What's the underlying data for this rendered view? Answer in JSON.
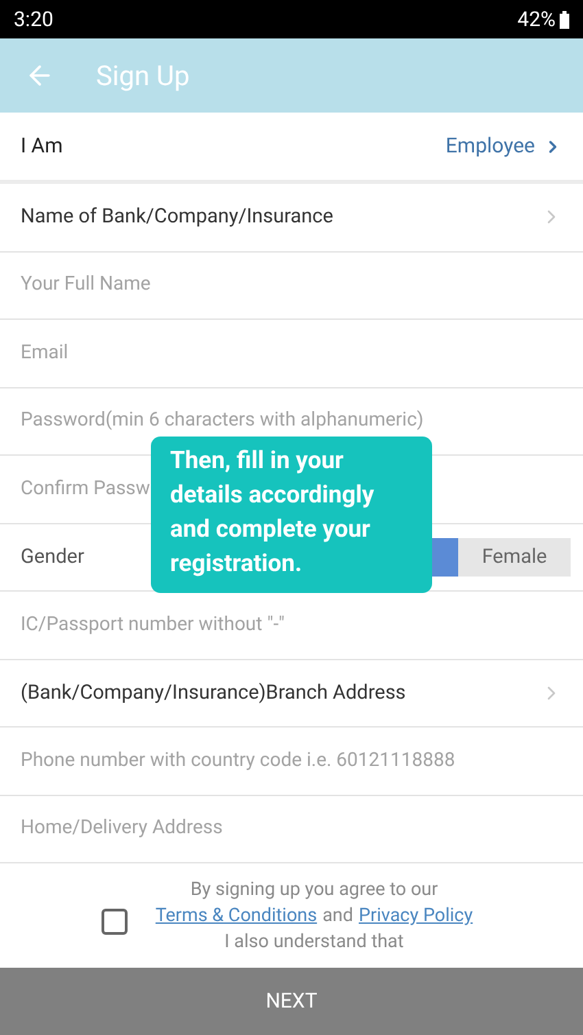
{
  "status_bar": {
    "time": "3:20",
    "battery": "42%"
  },
  "header": {
    "title": "Sign Up"
  },
  "role_row": {
    "label": "I Am",
    "value": "Employee"
  },
  "fields": [
    {
      "kind": "select",
      "label": "Name of Bank/Company/Insurance"
    },
    {
      "kind": "input",
      "placeholder": "Your Full Name"
    },
    {
      "kind": "input",
      "placeholder": "Email"
    },
    {
      "kind": "input",
      "placeholder": "Password(min 6 characters with alphanumeric)"
    },
    {
      "kind": "input",
      "placeholder": "Confirm Passw"
    },
    {
      "kind": "gender",
      "label": "Gender",
      "options": [
        {
          "selected": true
        },
        {
          "label": "Female",
          "selected": false
        }
      ]
    },
    {
      "kind": "input",
      "placeholder": "IC/Passport number without \"-\""
    },
    {
      "kind": "select",
      "label": "(Bank/Company/Insurance)Branch Address"
    },
    {
      "kind": "input",
      "placeholder": "Phone number with country code i.e. 60121118888"
    },
    {
      "kind": "input",
      "placeholder": "Home/Delivery Address"
    }
  ],
  "consent": {
    "checked": false,
    "intro": "By signing up you agree to our",
    "terms_link": "Terms & Conditions",
    "and": "and",
    "privacy_link": "Privacy Policy",
    "understand": "I also understand that"
  },
  "tooltip": {
    "text": "Then, fill in your details accordingly and complete your registration."
  },
  "next_button": {
    "label": "NEXT"
  }
}
